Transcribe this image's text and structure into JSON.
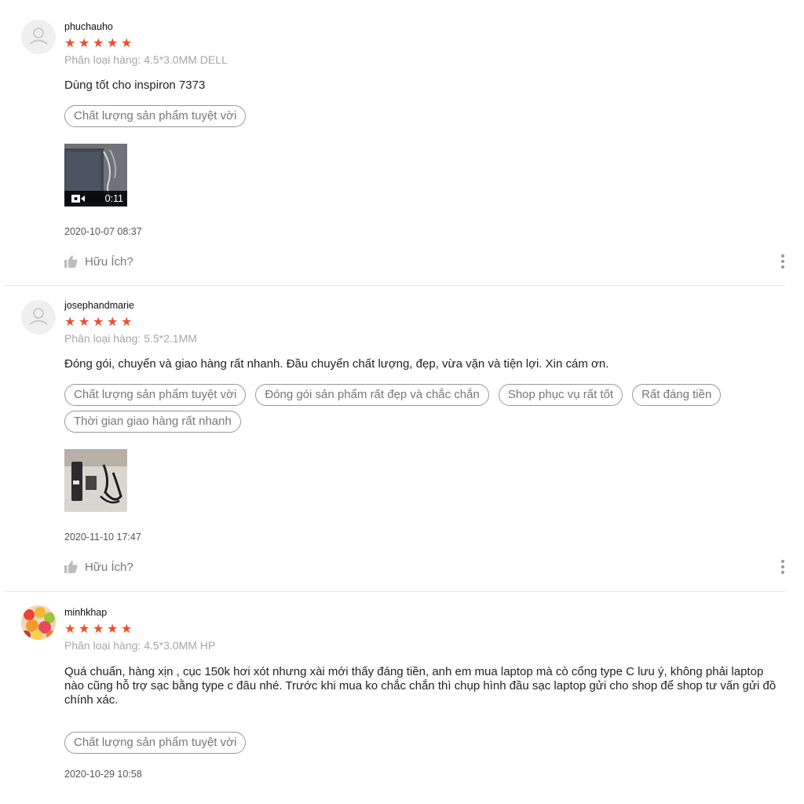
{
  "reviews": [
    {
      "username": "phuchauho",
      "rating": 5,
      "variation": "Phân loại hàng: 4.5*3.0MM DELL",
      "comment": "Dùng tốt cho inspiron 7373",
      "tags": [
        "Chất lượng sản phẩm tuyệt vời"
      ],
      "media": {
        "type": "video",
        "duration": "0:11"
      },
      "timestamp": "2020-10-07 08:37",
      "helpful_label": "Hữu Ích?"
    },
    {
      "username": "josephandmarie",
      "rating": 5,
      "variation": "Phân loại hàng: 5.5*2.1MM",
      "comment": "Đóng gói, chuyển và giao hàng rất nhanh. Đầu chuyển chất lượng, đẹp, vừa vặn và tiện lợi. Xin cám ơn.",
      "tags": [
        "Chất lượng sản phẩm tuyệt vời",
        "Đóng gói sản phẩm rất đẹp và chắc chắn",
        "Shop phục vụ rất tốt",
        "Rất đáng tiền",
        "Thời gian giao hàng rất nhanh"
      ],
      "media": {
        "type": "image"
      },
      "timestamp": "2020-11-10 17:47",
      "helpful_label": "Hữu Ích?"
    },
    {
      "username": "minhkhap",
      "rating": 5,
      "variation": "Phân loại hàng: 4.5*3.0MM HP",
      "comment": "Quá chuẩn, hàng xịn , cục 150k hơi xót nhưng xài mới thấy đáng tiền, anh em mua laptop mà cò cổng type C lưu ý, không phải laptop nào cũng hỗ trợ sạc bằng type c đâu nhé. Trước khi mua ko chắc chắn thì chụp hình đầu sạc laptop gửi cho shop để shop tư vấn gửi đồ chính xác.",
      "tags": [
        "Chất lượng sản phẩm tuyệt vời"
      ],
      "timestamp": "2020-10-29 10:58"
    }
  ],
  "colors": {
    "star": "#ee4d2d",
    "muted": "#a6a6a6",
    "tag_border": "#999999"
  },
  "icons": {
    "star": "star-icon",
    "avatar": "user-avatar-icon",
    "video": "video-camera-icon",
    "helpful": "thumbs-up-icon",
    "more": "more-vertical-icon"
  }
}
